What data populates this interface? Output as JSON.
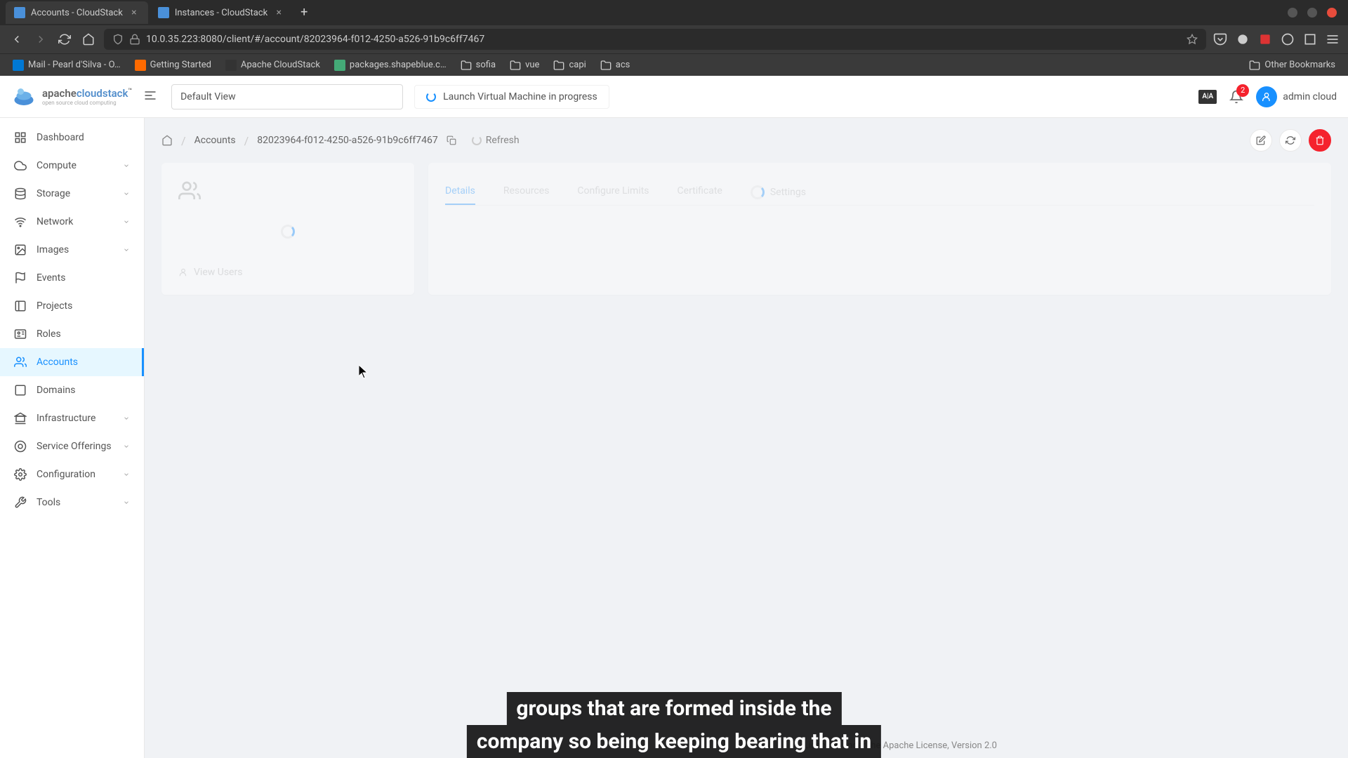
{
  "browser": {
    "tabs": [
      {
        "title": "Accounts - CloudStack",
        "active": true
      },
      {
        "title": "Instances - CloudStack",
        "active": false
      }
    ],
    "url": "10.0.35.223:8080/client/#/account/82023964-f012-4250-a526-91b9c6ff7467",
    "bookmarks": [
      {
        "label": "Mail - Pearl d'Silva - O…",
        "color": "#0078d4"
      },
      {
        "label": "Getting Started",
        "color": "#ff6a00"
      },
      {
        "label": "Apache CloudStack",
        "color": "#333"
      },
      {
        "label": "packages.shapeblue.c…",
        "color": "#4a7"
      },
      {
        "label": "sofia",
        "folder": true
      },
      {
        "label": "vue",
        "folder": true
      },
      {
        "label": "capi",
        "folder": true
      },
      {
        "label": "acs",
        "folder": true
      }
    ],
    "other_bookmarks": "Other Bookmarks"
  },
  "header": {
    "logo_brand": "apache",
    "logo_product": "cloudstack",
    "logo_sub": "open source cloud computing",
    "view_label": "Default View",
    "progress_text": "Launch Virtual Machine in progress",
    "lang_badge": "A|A",
    "notification_count": "2",
    "user_name": "admin cloud"
  },
  "sidebar": {
    "items": [
      {
        "label": "Dashboard",
        "icon": "dashboard",
        "expandable": false
      },
      {
        "label": "Compute",
        "icon": "cloud",
        "expandable": true
      },
      {
        "label": "Storage",
        "icon": "database",
        "expandable": true
      },
      {
        "label": "Network",
        "icon": "wifi",
        "expandable": true
      },
      {
        "label": "Images",
        "icon": "image",
        "expandable": true
      },
      {
        "label": "Events",
        "icon": "flag",
        "expandable": false
      },
      {
        "label": "Projects",
        "icon": "project",
        "expandable": false
      },
      {
        "label": "Roles",
        "icon": "idcard",
        "expandable": false
      },
      {
        "label": "Accounts",
        "icon": "team",
        "expandable": false,
        "active": true
      },
      {
        "label": "Domains",
        "icon": "block",
        "expandable": false
      },
      {
        "label": "Infrastructure",
        "icon": "bank",
        "expandable": true
      },
      {
        "label": "Service Offerings",
        "icon": "offering",
        "expandable": true
      },
      {
        "label": "Configuration",
        "icon": "setting",
        "expandable": true
      },
      {
        "label": "Tools",
        "icon": "tool",
        "expandable": true
      }
    ]
  },
  "breadcrumb": {
    "home_icon": "home",
    "items": [
      "Accounts",
      "82023964-f012-4250-a526-91b9c6ff7467"
    ],
    "refresh_label": "Refresh"
  },
  "detail": {
    "view_users_label": "View Users",
    "tabs": [
      "Details",
      "Resources",
      "Configure Limits",
      "Certificate",
      "Settings"
    ]
  },
  "footer": {
    "license": "Licensed under the Apache License, Version 2.0"
  },
  "caption": {
    "line1": "groups that are formed inside the",
    "line2": "company so being keeping bearing that in"
  }
}
